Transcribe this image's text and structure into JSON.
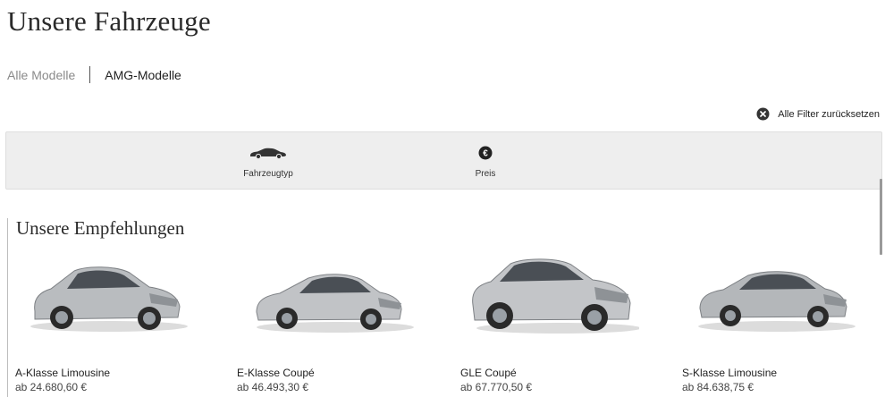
{
  "header": {
    "title": "Unsere Fahrzeuge"
  },
  "tabs": [
    {
      "label": "Alle Modelle",
      "active": false
    },
    {
      "label": "AMG-Modelle",
      "active": true
    }
  ],
  "filters": {
    "reset_label": "Alle Filter zurücksetzen",
    "items": [
      {
        "label": "Fahrzeugtyp",
        "icon": "car-icon"
      },
      {
        "label": "Preis",
        "icon": "euro-icon"
      }
    ]
  },
  "recommendations": {
    "title": "Unsere Empfehlungen",
    "cars": [
      {
        "name": "A-Klasse Limousine",
        "price": "ab 24.680,60 €",
        "icon": "car-image"
      },
      {
        "name": "E-Klasse Coupé",
        "price": "ab 46.493,30 €",
        "icon": "car-image"
      },
      {
        "name": "GLE  Coupé",
        "price": "ab 67.770,50 €",
        "icon": "car-image"
      },
      {
        "name": "S-Klasse Limousine",
        "price": "ab 84.638,75 €",
        "icon": "car-image"
      }
    ]
  },
  "colors": {
    "filter_bar": "#eeeeee",
    "text": "#222222",
    "muted": "#8a8a8a"
  }
}
